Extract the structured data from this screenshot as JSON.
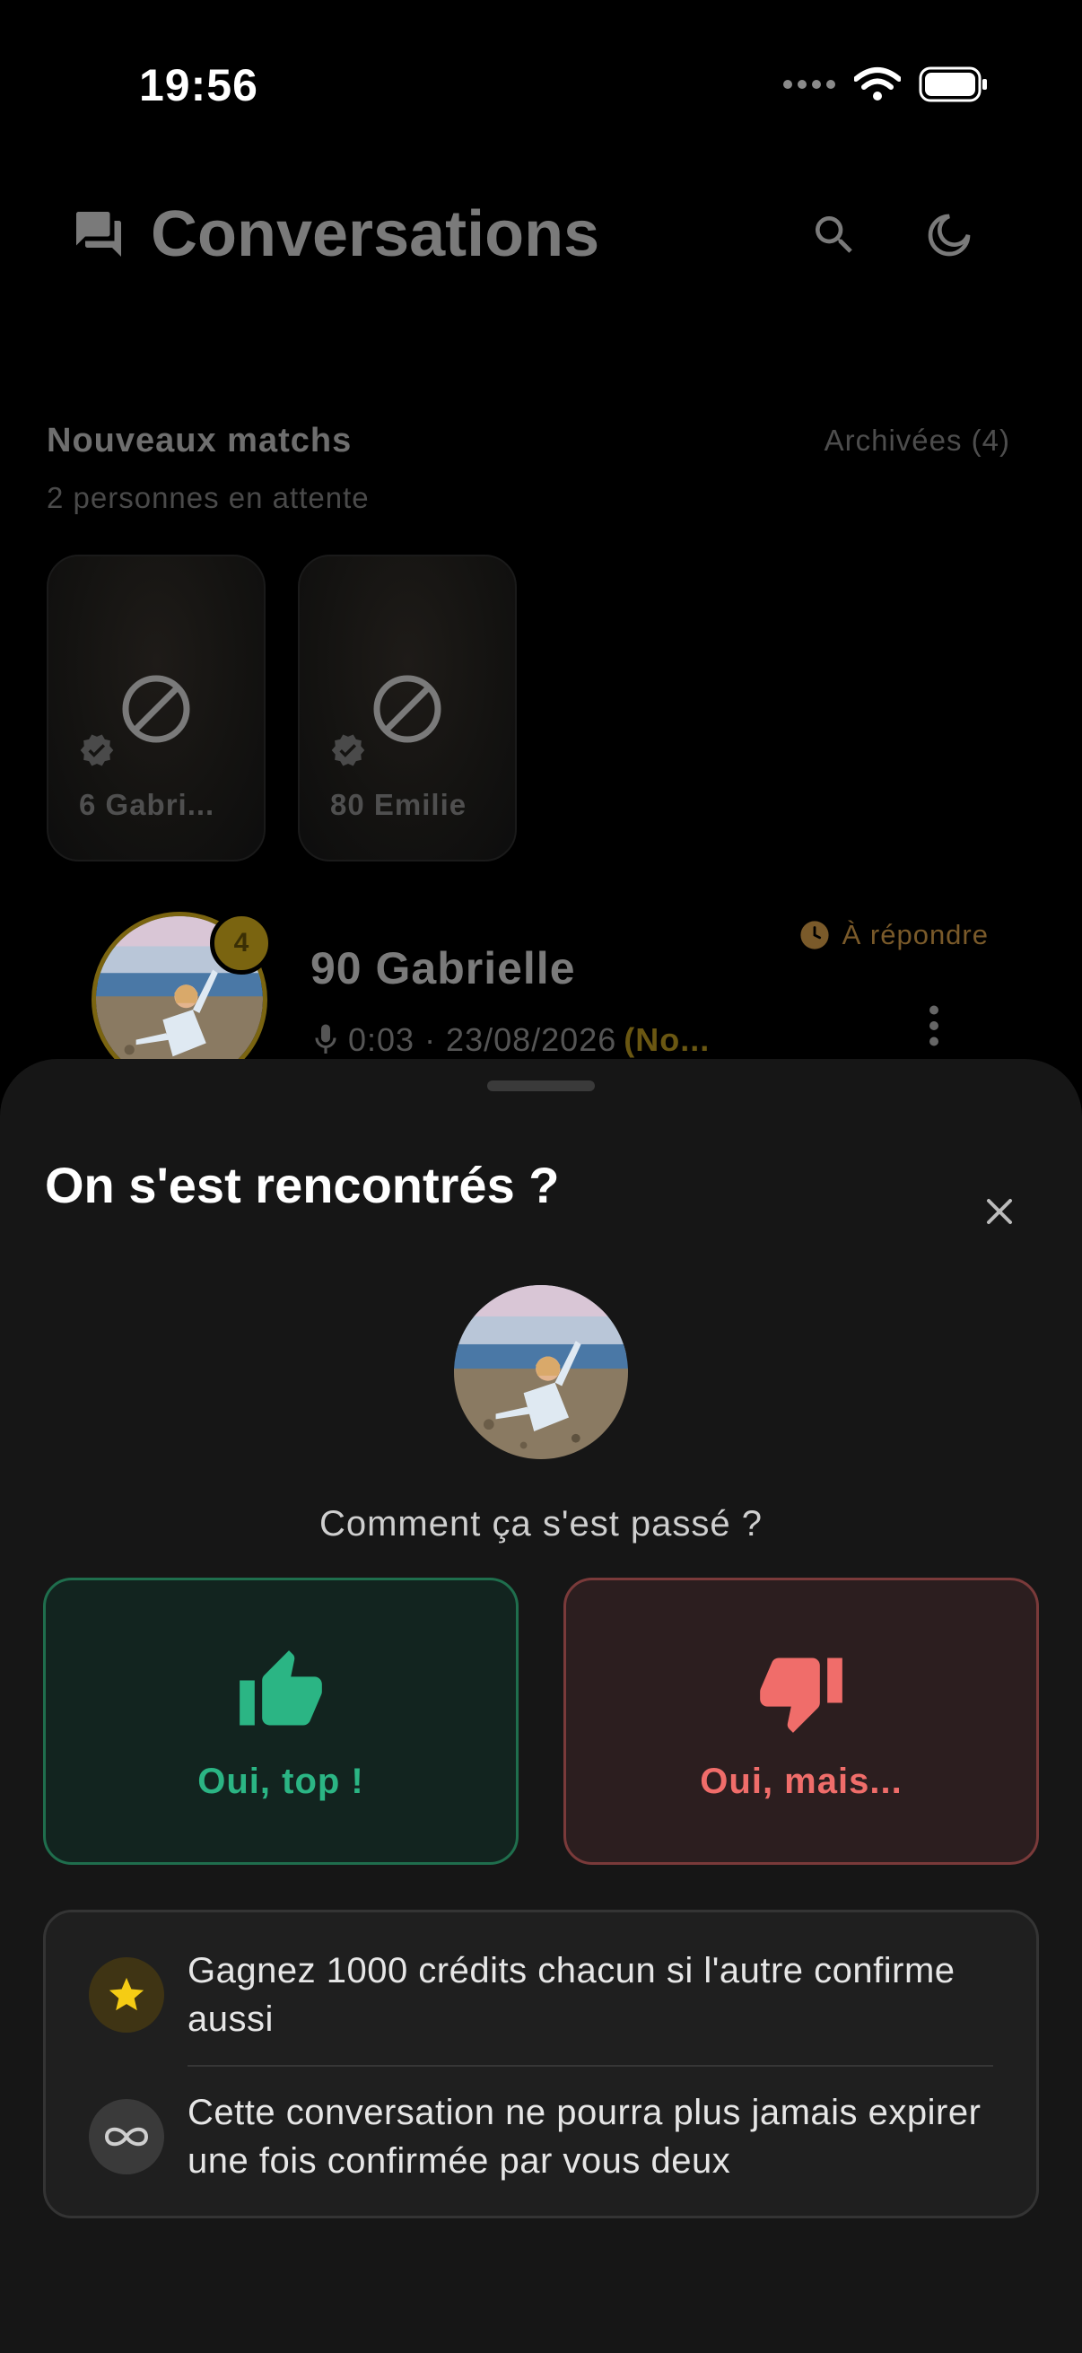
{
  "status_bar": {
    "time": "19:56"
  },
  "header": {
    "title": "Conversations"
  },
  "new_matches": {
    "title": "Nouveaux matchs",
    "subtitle": "2 personnes en attente",
    "archived_label": "Archivées (4)",
    "cards": [
      {
        "name": "6 Gabri..."
      },
      {
        "name": "80 Emilie"
      }
    ]
  },
  "conversation": {
    "name": "90 Gabrielle",
    "unread_count": "4",
    "status": "À répondre",
    "preview": "0:03 · 23/08/2026",
    "preview_highlight": "(No..."
  },
  "sheet": {
    "title": "On s'est rencontrés ?",
    "question": "Comment ça s'est passé ?",
    "yes_label": "Oui, top !",
    "no_label": "Oui, mais...",
    "info": [
      {
        "icon": "star-icon",
        "text": "Gagnez 1000 crédits chacun si l'autre confirme aussi"
      },
      {
        "icon": "infinity-icon",
        "text": "Cette conversation ne pourra plus jamais expirer une fois confirmée par vous deux"
      }
    ]
  },
  "colors": {
    "accent_green": "#2bb584",
    "accent_red": "#f06d6a",
    "gold": "#e0b81c"
  }
}
